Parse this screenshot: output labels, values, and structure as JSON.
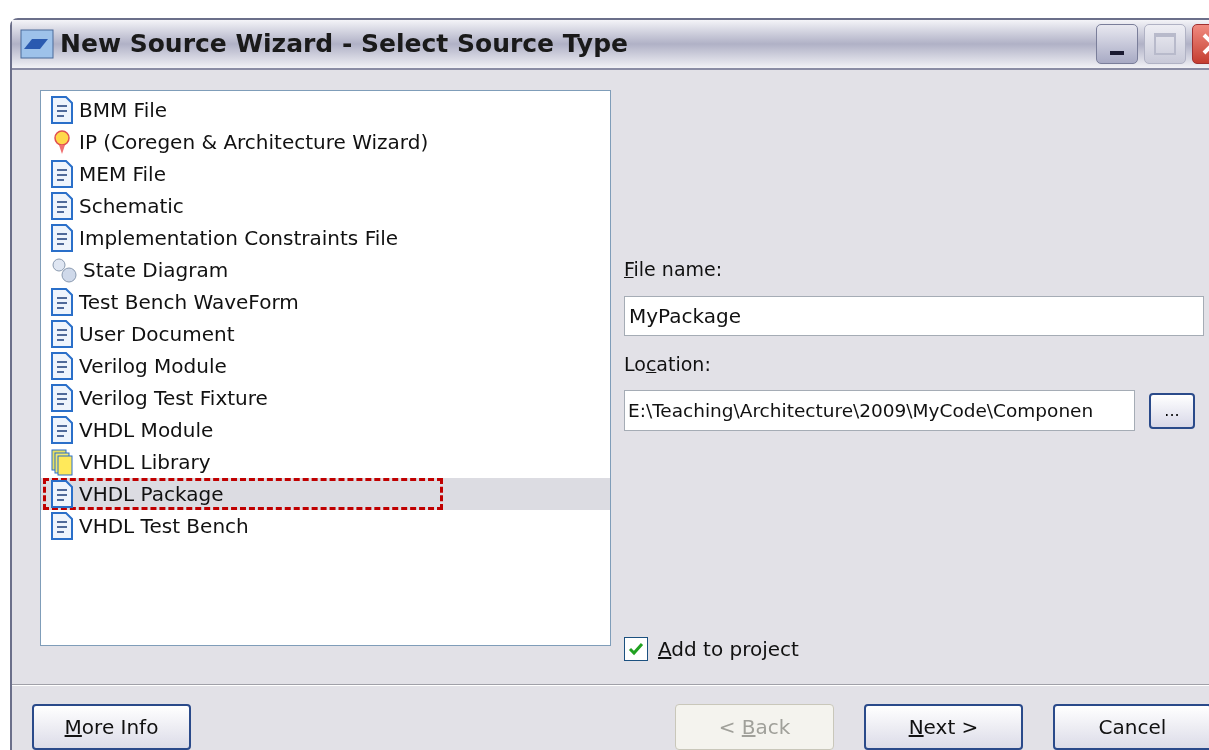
{
  "window": {
    "title": "New Source Wizard - Select Source Type"
  },
  "source_types": [
    {
      "label": "BMM File",
      "kind": "document",
      "selected": false,
      "highlighted": false
    },
    {
      "label": "IP (Coregen & Architecture Wizard)",
      "kind": "bulb",
      "selected": false,
      "highlighted": false
    },
    {
      "label": "MEM File",
      "kind": "document",
      "selected": false,
      "highlighted": false
    },
    {
      "label": "Schematic",
      "kind": "document",
      "selected": false,
      "highlighted": false
    },
    {
      "label": "Implementation Constraints File",
      "kind": "document",
      "selected": false,
      "highlighted": false
    },
    {
      "label": "State Diagram",
      "kind": "circles",
      "selected": false,
      "highlighted": false
    },
    {
      "label": "Test Bench WaveForm",
      "kind": "document",
      "selected": false,
      "highlighted": false
    },
    {
      "label": "User Document",
      "kind": "document",
      "selected": false,
      "highlighted": false
    },
    {
      "label": "Verilog Module",
      "kind": "document",
      "selected": false,
      "highlighted": false
    },
    {
      "label": "Verilog Test Fixture",
      "kind": "document",
      "selected": false,
      "highlighted": false
    },
    {
      "label": "VHDL Module",
      "kind": "document",
      "selected": false,
      "highlighted": false
    },
    {
      "label": "VHDL Library",
      "kind": "folders",
      "selected": false,
      "highlighted": false
    },
    {
      "label": "VHDL Package",
      "kind": "document",
      "selected": true,
      "highlighted": true
    },
    {
      "label": "VHDL Test Bench",
      "kind": "document",
      "selected": false,
      "highlighted": false
    }
  ],
  "file_name": {
    "label": [
      {
        "text": "F",
        "underlined": true
      },
      {
        "text": "ile name:",
        "underlined": false
      }
    ],
    "value": "MyPackage"
  },
  "location": {
    "label": [
      {
        "text": "Lo",
        "underlined": false
      },
      {
        "text": "c",
        "underlined": true
      },
      {
        "text": "ation:",
        "underlined": false
      }
    ],
    "value": "E:\\Teaching\\Architecture\\2009\\MyCode\\Componen",
    "browse_button": "..."
  },
  "add_to_project": {
    "label": [
      {
        "text": "A",
        "underlined": true
      },
      {
        "text": "dd to project",
        "underlined": false
      }
    ],
    "checked": true
  },
  "buttons": [
    {
      "label": [
        {
          "text": "M",
          "underlined": true
        },
        {
          "text": "ore Info",
          "underlined": false
        }
      ],
      "disabled": false
    },
    {
      "label": [
        {
          "text": "< ",
          "underlined": false
        },
        {
          "text": "B",
          "underlined": true
        },
        {
          "text": "ack",
          "underlined": false
        }
      ],
      "disabled": true
    },
    {
      "label": [
        {
          "text": "N",
          "underlined": true
        },
        {
          "text": "ext >",
          "underlined": false
        }
      ],
      "disabled": false
    },
    {
      "label": [
        {
          "text": "Cancel",
          "underlined": false
        }
      ],
      "disabled": false
    }
  ]
}
